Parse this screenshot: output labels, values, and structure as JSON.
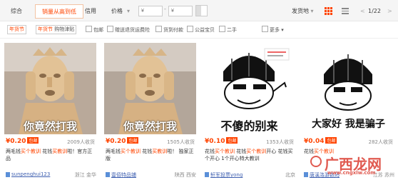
{
  "sortbar": {
    "tabs": [
      "综合",
      "销量从高到低",
      "信用",
      "价格"
    ],
    "active_tab": 1,
    "price_min_placeholder": "¥",
    "price_max_placeholder": "¥",
    "price_dash": "-",
    "ship_from": "发货地",
    "page_indicator": "1/22",
    "prev": "<",
    "next": ">",
    "price_arrow": "▾",
    "ship_arrow": "▾"
  },
  "filters": {
    "chip1": {
      "tag": "年货节",
      "text": ""
    },
    "chip2": {
      "tag": "年货节",
      "text": "购物津贴"
    },
    "checkboxes": [
      "包邮",
      "赠送退货运费险",
      "货到付款",
      "公益宝贝",
      "二手"
    ],
    "more": "更多"
  },
  "products": [
    {
      "price": "¥0.20",
      "badge": "包邮",
      "sales": "2009人收货",
      "title_pre": "两毛钱",
      "title_hl1": "买个教训",
      " title_mid": "",
      "title_rest": "花钱",
      "title_hl2": "买教训",
      "title_end": "啦！官方正品",
      "shop": "sunpenghui123",
      "location": "浙江 金华",
      "caption": "你竟然打我"
    },
    {
      "price": "¥0.20",
      "badge": "包邮",
      "sales": "1505人收货",
      "title_pre": "两毛钱",
      "title_hl1": "买个教训",
      "title_rest": "花钱",
      "title_hl2": "买教训",
      "title_end": "啦！ 独家正版",
      "shop": "壹佰特品铺",
      "location": "陕西 西安",
      "caption": "你竟然打我"
    },
    {
      "price": "¥0.10",
      "badge": "包邮",
      "sales": "1353人收货",
      "title_pre": "花钱",
      "title_hl1": "买个教训",
      "title_rest": "花钱",
      "title_hl2": "买个教训",
      "title_end": "开心 花钱买个开心 1个开心特大教训",
      "shop": "轩军投票yong",
      "location": "北京",
      "caption": "不傻的别来"
    },
    {
      "price": "¥0.04",
      "badge": "包邮",
      "sales": "282人收货",
      "title_pre": "花钱",
      "title_hl1": "买个教训",
      "title_rest": "",
      "title_hl2": "",
      "title_end": "",
      "shop": "唐溪洛游数码",
      "location": "江苏 苏州",
      "caption": "大家好 我是骗子"
    }
  ],
  "watermark": {
    "text": "广西龙网",
    "sub": "www.cngxlw.com"
  },
  "colors": {
    "accent": "#ff4400",
    "link": "#3e5fb0"
  }
}
